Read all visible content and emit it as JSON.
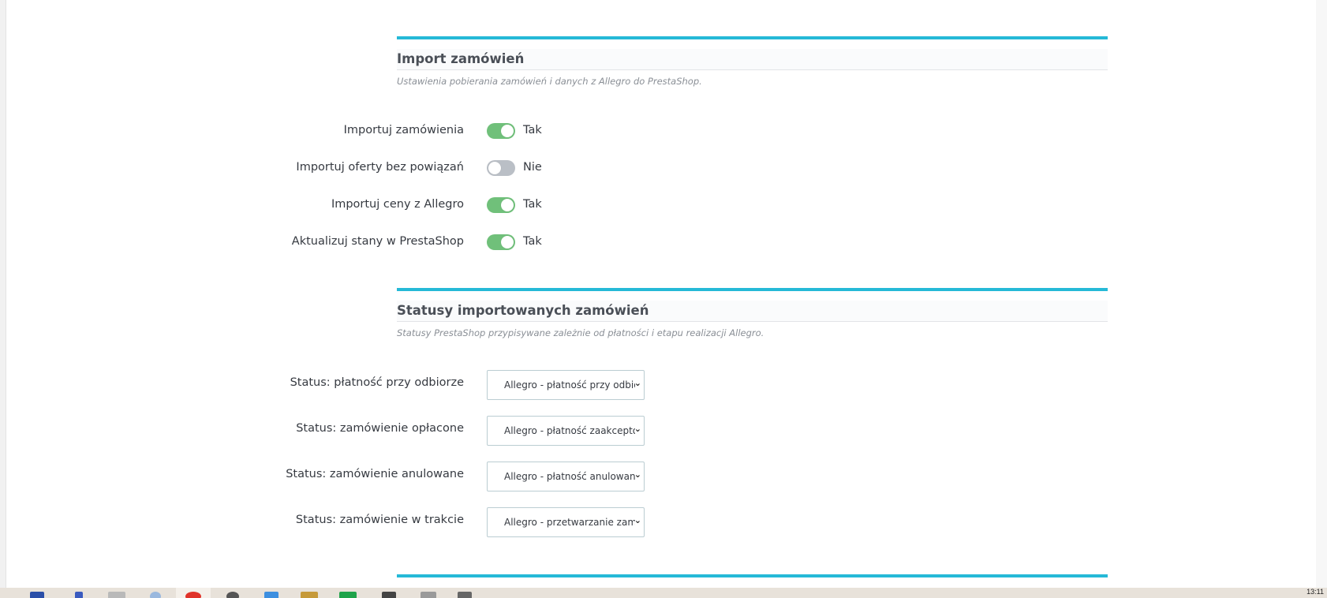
{
  "sections": [
    {
      "title": "Import zamówień",
      "description": "Ustawienia pobierania zamówień i danych z Allegro do PrestaShop."
    },
    {
      "title": "Statusy importowanych zamówień",
      "description": "Statusy PrestaShop przypisywane zależnie od płatności i etapu realizacji Allegro."
    }
  ],
  "toggles": [
    {
      "label": "Importuj zamówienia",
      "state": true,
      "state_text": "Tak"
    },
    {
      "label": "Importuj oferty bez powiązań",
      "state": false,
      "state_text": "Nie"
    },
    {
      "label": "Importuj ceny z Allegro",
      "state": true,
      "state_text": "Tak"
    },
    {
      "label": "Aktualizuj stany w PrestaShop",
      "state": true,
      "state_text": "Tak"
    }
  ],
  "status_selects": [
    {
      "label": "Status: płatność przy odbiorze",
      "value": "Allegro - płatność przy odbiorze"
    },
    {
      "label": "Status: zamówienie opłacone",
      "value": "Allegro - płatność zaakceptowana"
    },
    {
      "label": "Status: zamówienie anulowane",
      "value": "Allegro - płatność anulowana"
    },
    {
      "label": "Status: zamówienie w trakcie",
      "value": "Allegro - przetwarzanie zamówienia"
    }
  ],
  "taskbar": {
    "clock": "13:11"
  },
  "colors": {
    "accent": "#25b9d7",
    "switch_on": "#70c07a",
    "switch_off": "#babfc6"
  },
  "icons": {
    "select_arrow": "chevron-down-icon"
  }
}
